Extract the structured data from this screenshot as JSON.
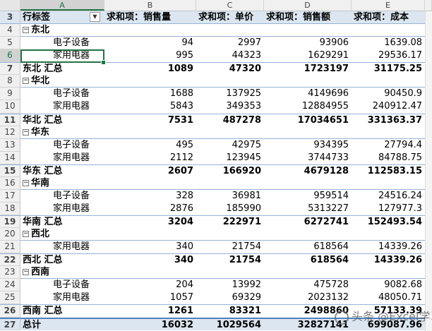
{
  "columns": [
    "A",
    "B",
    "C",
    "D",
    "E"
  ],
  "header": {
    "row": "3",
    "label": "行标签",
    "b": "求和项：销售量",
    "c": "求和项：单价",
    "d": "求和项：销售额",
    "e": "求和项：成本"
  },
  "rows": [
    {
      "n": "4",
      "type": "region",
      "label": "东北",
      "toggle": "⊟"
    },
    {
      "n": "5",
      "type": "item",
      "label": "电子设备",
      "b": "94",
      "c": "2997",
      "d": "93906",
      "e": "1639.08"
    },
    {
      "n": "6",
      "type": "item",
      "label": "家用电器",
      "b": "995",
      "c": "44323",
      "d": "1629291",
      "e": "29536.17"
    },
    {
      "n": "7",
      "type": "sub",
      "label": "东北 汇总",
      "b": "1089",
      "c": "47320",
      "d": "1723197",
      "e": "31175.25"
    },
    {
      "n": "8",
      "type": "region",
      "label": "华北",
      "toggle": "⊟"
    },
    {
      "n": "9",
      "type": "item",
      "label": "电子设备",
      "b": "1688",
      "c": "137925",
      "d": "4149696",
      "e": "90450.9"
    },
    {
      "n": "10",
      "type": "item",
      "label": "家用电器",
      "b": "5843",
      "c": "349353",
      "d": "12884955",
      "e": "240912.47"
    },
    {
      "n": "11",
      "type": "sub",
      "label": "华北 汇总",
      "b": "7531",
      "c": "487278",
      "d": "17034651",
      "e": "331363.37"
    },
    {
      "n": "12",
      "type": "region",
      "label": "华东",
      "toggle": "⊟"
    },
    {
      "n": "13",
      "type": "item",
      "label": "电子设备",
      "b": "495",
      "c": "42975",
      "d": "934395",
      "e": "27794.4"
    },
    {
      "n": "14",
      "type": "item",
      "label": "家用电器",
      "b": "2112",
      "c": "123945",
      "d": "3744733",
      "e": "84788.75"
    },
    {
      "n": "15",
      "type": "sub",
      "label": "华东 汇总",
      "b": "2607",
      "c": "166920",
      "d": "4679128",
      "e": "112583.15"
    },
    {
      "n": "16",
      "type": "region",
      "label": "华南",
      "toggle": "⊟"
    },
    {
      "n": "17",
      "type": "item",
      "label": "电子设备",
      "b": "328",
      "c": "36981",
      "d": "959514",
      "e": "24516.24"
    },
    {
      "n": "18",
      "type": "item",
      "label": "家用电器",
      "b": "2876",
      "c": "185990",
      "d": "5313227",
      "e": "127977.3"
    },
    {
      "n": "19",
      "type": "sub",
      "label": "华南 汇总",
      "b": "3204",
      "c": "222971",
      "d": "6272741",
      "e": "152493.54"
    },
    {
      "n": "20",
      "type": "region",
      "label": "西北",
      "toggle": "⊟"
    },
    {
      "n": "21",
      "type": "item",
      "label": "家用电器",
      "b": "340",
      "c": "21754",
      "d": "618564",
      "e": "14339.26"
    },
    {
      "n": "22",
      "type": "sub",
      "label": "西北 汇总",
      "b": "340",
      "c": "21754",
      "d": "618564",
      "e": "14339.26"
    },
    {
      "n": "23",
      "type": "region",
      "label": "西南",
      "toggle": "⊟"
    },
    {
      "n": "24",
      "type": "item",
      "label": "电子设备",
      "b": "204",
      "c": "13992",
      "d": "475728",
      "e": "9082.68"
    },
    {
      "n": "25",
      "type": "item",
      "label": "家用电器",
      "b": "1057",
      "c": "69329",
      "d": "2023132",
      "e": "48050.71"
    },
    {
      "n": "26",
      "type": "sub",
      "label": "西南 汇总",
      "b": "1261",
      "c": "83321",
      "d": "2498860",
      "e": "57133.39"
    },
    {
      "n": "27",
      "type": "total",
      "label": "总计",
      "b": "16032",
      "c": "1029564",
      "d": "32827141",
      "e": "699087.96"
    }
  ],
  "watermark": "头条 @Excel学习",
  "colors": {
    "accent": "#217346",
    "pivot_header": "#dce6f1",
    "pivot_line": "#95b3d7",
    "total_line": "#4f81bd"
  },
  "icons": {
    "dropdown": "dropdown-arrow-icon",
    "collapse": "collapse-minus-icon"
  }
}
